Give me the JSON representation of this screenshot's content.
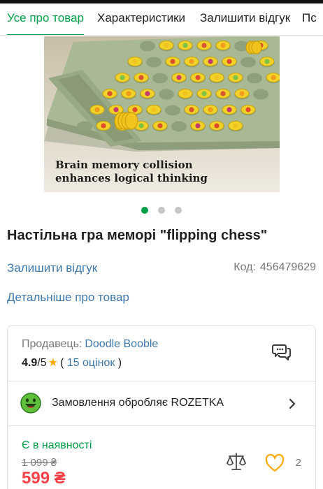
{
  "tabs": [
    {
      "label": "Усе про товар",
      "active": true
    },
    {
      "label": "Характеристики",
      "active": false
    },
    {
      "label": "Залишити відгук",
      "active": false
    },
    {
      "label": "Пс",
      "active": false
    }
  ],
  "gallery": {
    "caption_line1": "Brain memory collision",
    "caption_line2": "enhances logical thinking",
    "slide_count": 3,
    "active_slide": 1
  },
  "product": {
    "title": "Настільна гра меморі \"flipping chess\"",
    "review_link": "Залишити відгук",
    "code_label": "Код:",
    "code_value": "456479629",
    "details_link": "Детальніше про товар"
  },
  "seller": {
    "label": "Продавець:",
    "name": "Doodle Booble",
    "rating": "4.9",
    "rating_max": "/5",
    "reviews_open": "(",
    "reviews": "15 оцінок",
    "reviews_close": ")"
  },
  "fulfillment": {
    "text": "Замовлення обробляє ROZETKA"
  },
  "offer": {
    "availability": "Є в наявності",
    "old_price": "1 099 ₴",
    "price": "599 ₴",
    "favorites_count": "2"
  },
  "colors": {
    "accent": "#00a046",
    "link": "#3e77aa",
    "price": "#f84147",
    "star": "#ffa900"
  },
  "icons": [
    "chat-icon",
    "rozetka-smiley-icon",
    "chevron-right-icon",
    "compare-scales-icon",
    "heart-icon",
    "star-icon"
  ]
}
